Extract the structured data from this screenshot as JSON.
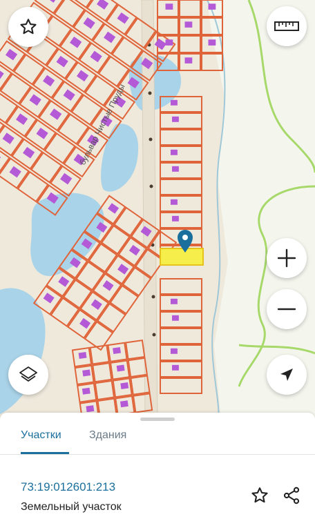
{
  "map": {
    "street_label": "бульвар Чистые Пруды",
    "colors": {
      "parcel_outline": "#e0643a",
      "building": "#b55ad6",
      "water": "#a9d3e8",
      "forest_edge": "#a7d86a",
      "selected_parcel": "#f6ee4b",
      "marker": "#1b6f9c"
    }
  },
  "controls": {
    "favorite_icon": "star-outline-icon",
    "ruler_icon": "ruler-icon",
    "zoom_in_icon": "plus-icon",
    "zoom_out_icon": "minus-icon",
    "layers_icon": "layers-icon",
    "location_icon": "navigation-arrow-icon"
  },
  "panel": {
    "tabs": [
      "Участки",
      "Здания"
    ],
    "active_tab": "Участки",
    "cadastral_number": "73:19:012601:213",
    "object_type": "Земельный участок",
    "favorite_icon": "star-outline-icon",
    "share_icon": "share-icon"
  }
}
